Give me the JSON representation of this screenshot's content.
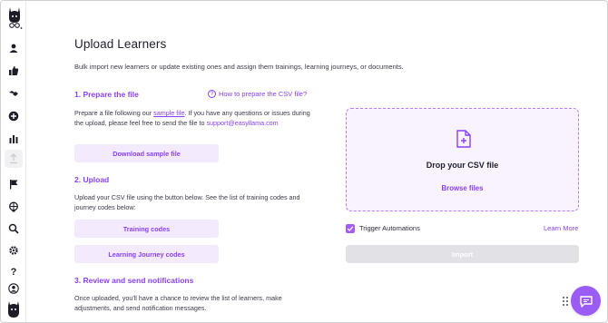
{
  "page": {
    "title": "Upload Learners",
    "subtitle": "Bulk import new learners or update existing ones and assign them trainings, learning journeys, or documents."
  },
  "colors": {
    "accent": "#8a3ffc",
    "accent_light": "#f3eafe",
    "dropzone_bg": "#f8f3fe",
    "disabled": "#e2e2e6"
  },
  "sidebar": {
    "items": [
      {
        "icon": "user-icon"
      },
      {
        "icon": "thumbs-up-icon"
      },
      {
        "icon": "handshake-icon"
      },
      {
        "icon": "plus-circle-icon"
      },
      {
        "icon": "bar-chart-icon"
      },
      {
        "icon": "upload-icon"
      },
      {
        "icon": "flag-icon"
      },
      {
        "icon": "brain-icon"
      },
      {
        "icon": "search-icon"
      },
      {
        "icon": "gear-icon"
      },
      {
        "icon": "help-icon"
      },
      {
        "icon": "account-icon"
      }
    ]
  },
  "section1": {
    "heading": "1. Prepare the file",
    "help_link": "How to prepare the CSV file?",
    "text_before": "Prepare a file following our ",
    "sample_link": "sample file",
    "text_after": ". If you have any questions or issues during the upload, please feel free to send the file to ",
    "email": "support@easyllama.com",
    "download_button": "Download sample file"
  },
  "section2": {
    "heading": "2. Upload",
    "text": "Upload your CSV file using the button below. See the list of training codes and journey codes below:",
    "training_codes_button": "Training codes",
    "journey_codes_button": "Learning Journey codes"
  },
  "section3": {
    "heading": "3. Review and send notifications",
    "text": "Once uploaded, you'll have a chance to review the list of learners, make adjustments, and send notification messages."
  },
  "dropzone": {
    "title": "Drop your CSV file",
    "browse": "Browse files"
  },
  "automations": {
    "label": "Trigger Automations",
    "checked": true,
    "learn_more": "Learn More"
  },
  "import_button": "Import"
}
